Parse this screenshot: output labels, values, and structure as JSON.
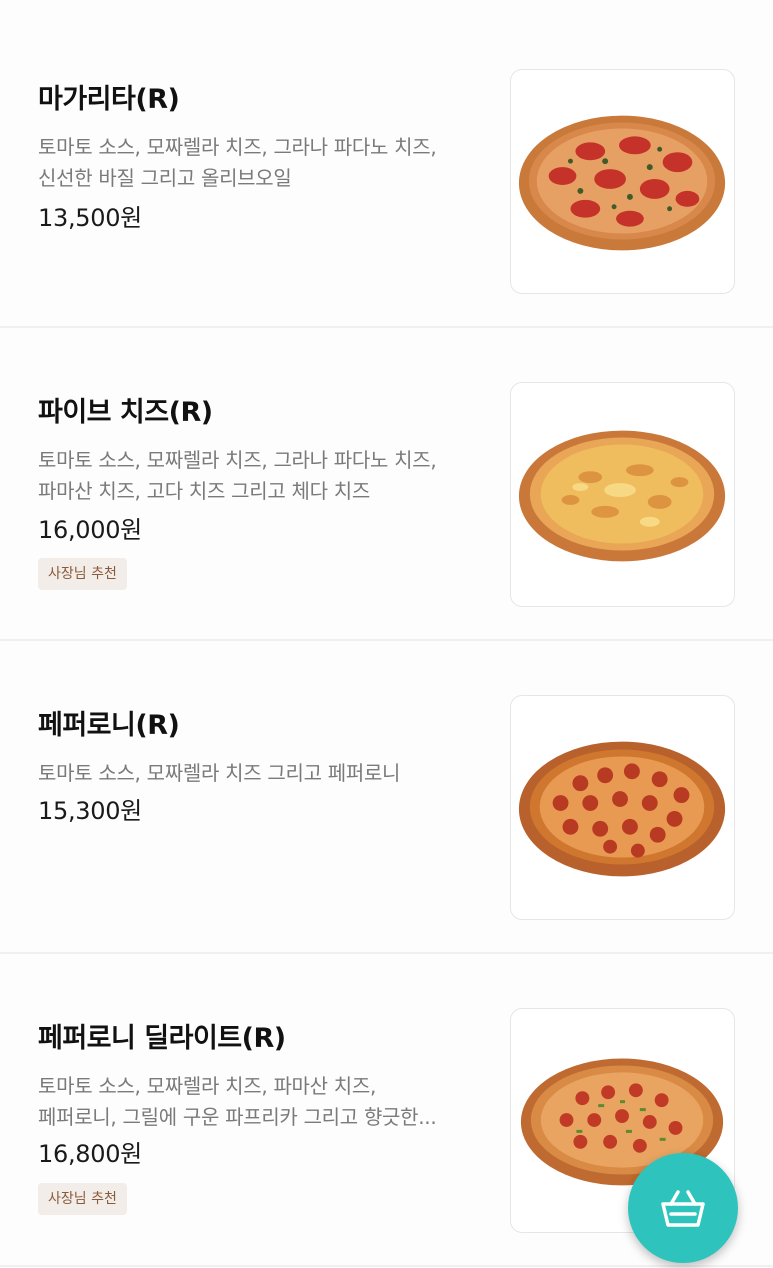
{
  "menu": [
    {
      "name": "마가리타(R)",
      "desc": [
        "토마토 소스, 모짜렐라 치즈, 그라나 파다노 치즈,",
        "신선한 바질  그리고 올리브오일"
      ],
      "price": "13,500원",
      "badge": ""
    },
    {
      "name": "파이브 치즈(R)",
      "desc": [
        "토마토 소스, 모짜렐라 치즈, 그라나 파다노 치즈,",
        "파마산 치즈, 고다 치즈 그리고 체다 치즈"
      ],
      "price": "16,000원",
      "badge": "사장님 추천"
    },
    {
      "name": "페퍼로니(R)",
      "desc": [
        "토마토 소스, 모짜렐라 치즈 그리고 페퍼로니"
      ],
      "price": "15,300원",
      "badge": ""
    },
    {
      "name": "페퍼로니 딜라이트(R)",
      "desc": [
        "토마토 소스, 모짜렐라 치즈, 파마산 치즈,",
        "페퍼로니, 그릴에 구운 파프리카 그리고 향긋한..."
      ],
      "price": "16,800원",
      "badge": "사장님 추천"
    }
  ],
  "cart": {
    "icon": "basket-icon",
    "color": "#2ec4bd"
  }
}
